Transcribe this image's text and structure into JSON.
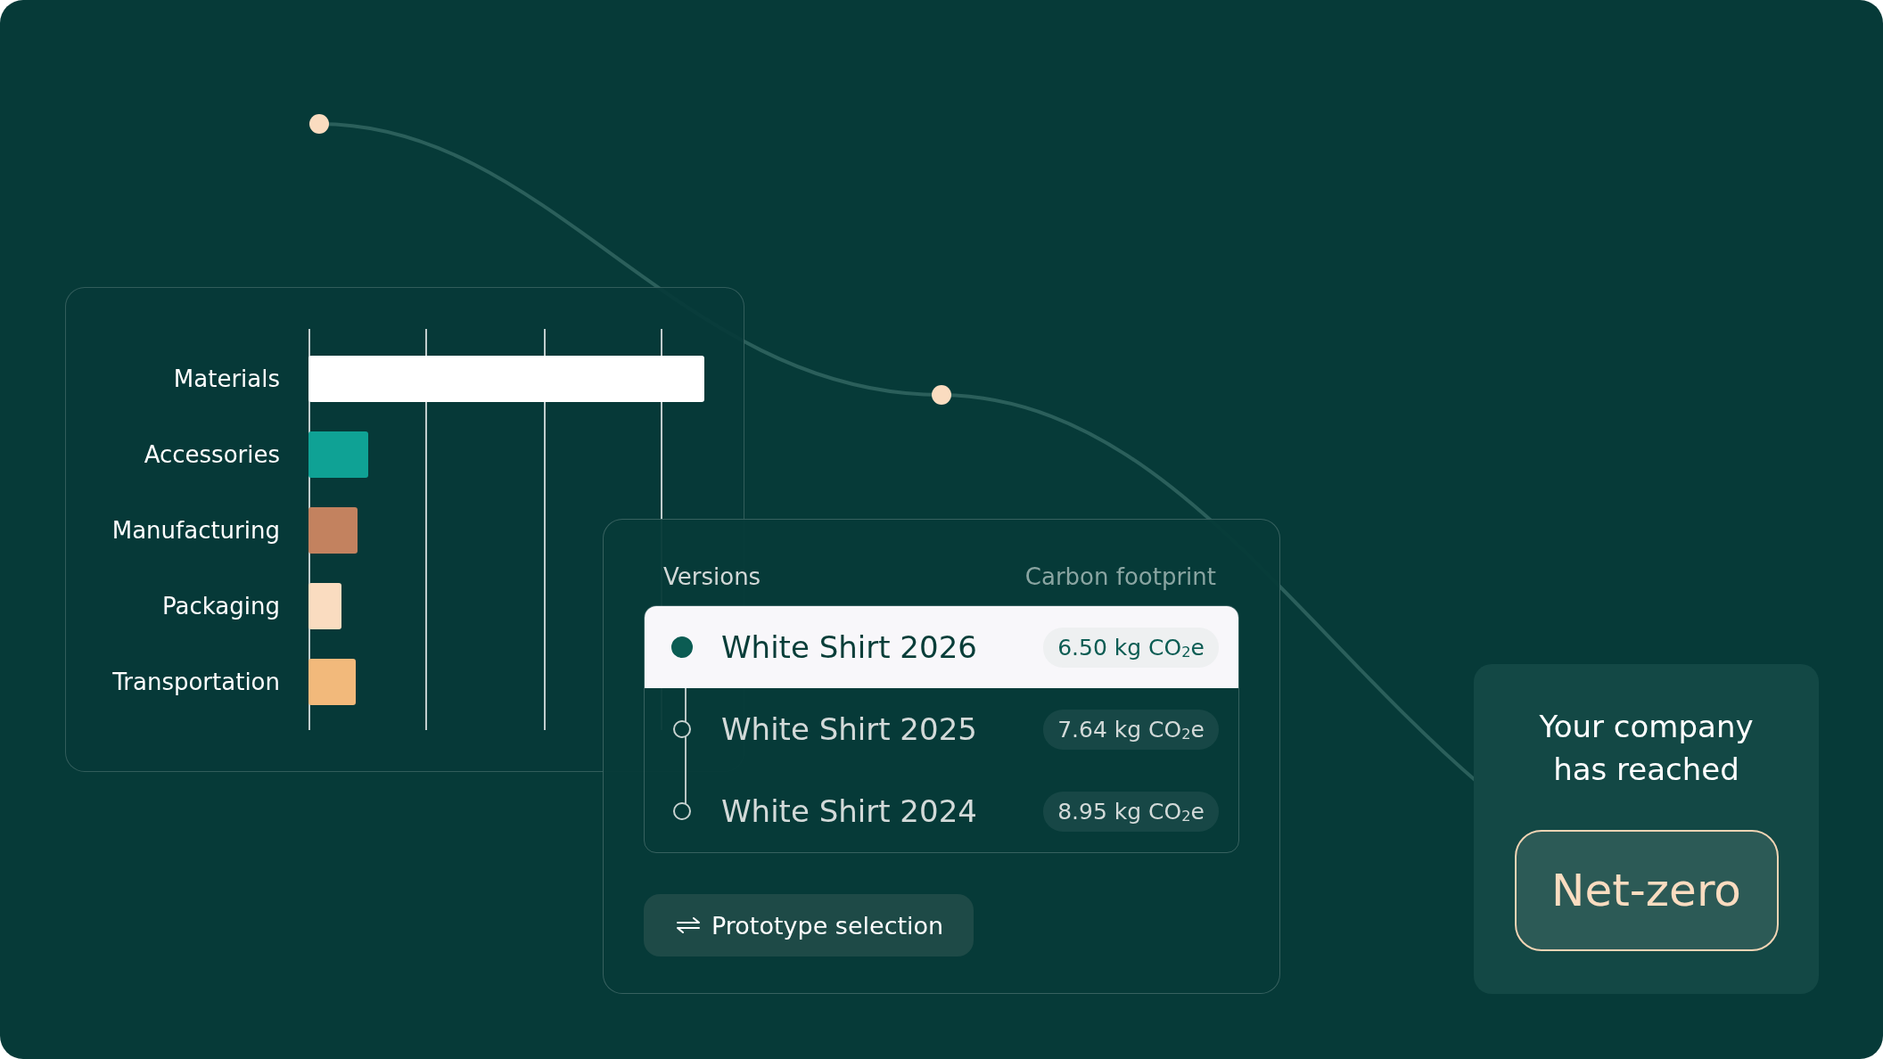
{
  "chart": {
    "bars": [
      {
        "label": "Materials",
        "color": "#ffffff"
      },
      {
        "label": "Accessories",
        "color": "#0fa295"
      },
      {
        "label": "Manufacturing",
        "color": "#c3825f"
      },
      {
        "label": "Packaging",
        "color": "#fadcc0"
      },
      {
        "label": "Transportation",
        "color": "#f2b97b"
      }
    ]
  },
  "versions": {
    "header": "Versions",
    "column_header": "Carbon footprint",
    "items": [
      {
        "name": "White Shirt 2026",
        "footprint": "6.50 kg CO$_{2}$e",
        "selected": true
      },
      {
        "name": "White Shirt 2025",
        "footprint": "7.64 kg CO$_{2}$e",
        "selected": false
      },
      {
        "name": "White Shirt 2024",
        "footprint": "8.95 kg CO$_{2}$e",
        "selected": false
      }
    ],
    "button": {
      "label": "Prototype selection"
    }
  },
  "status_card": {
    "message": "Your company has reached",
    "badge": "Net-zero"
  }
}
